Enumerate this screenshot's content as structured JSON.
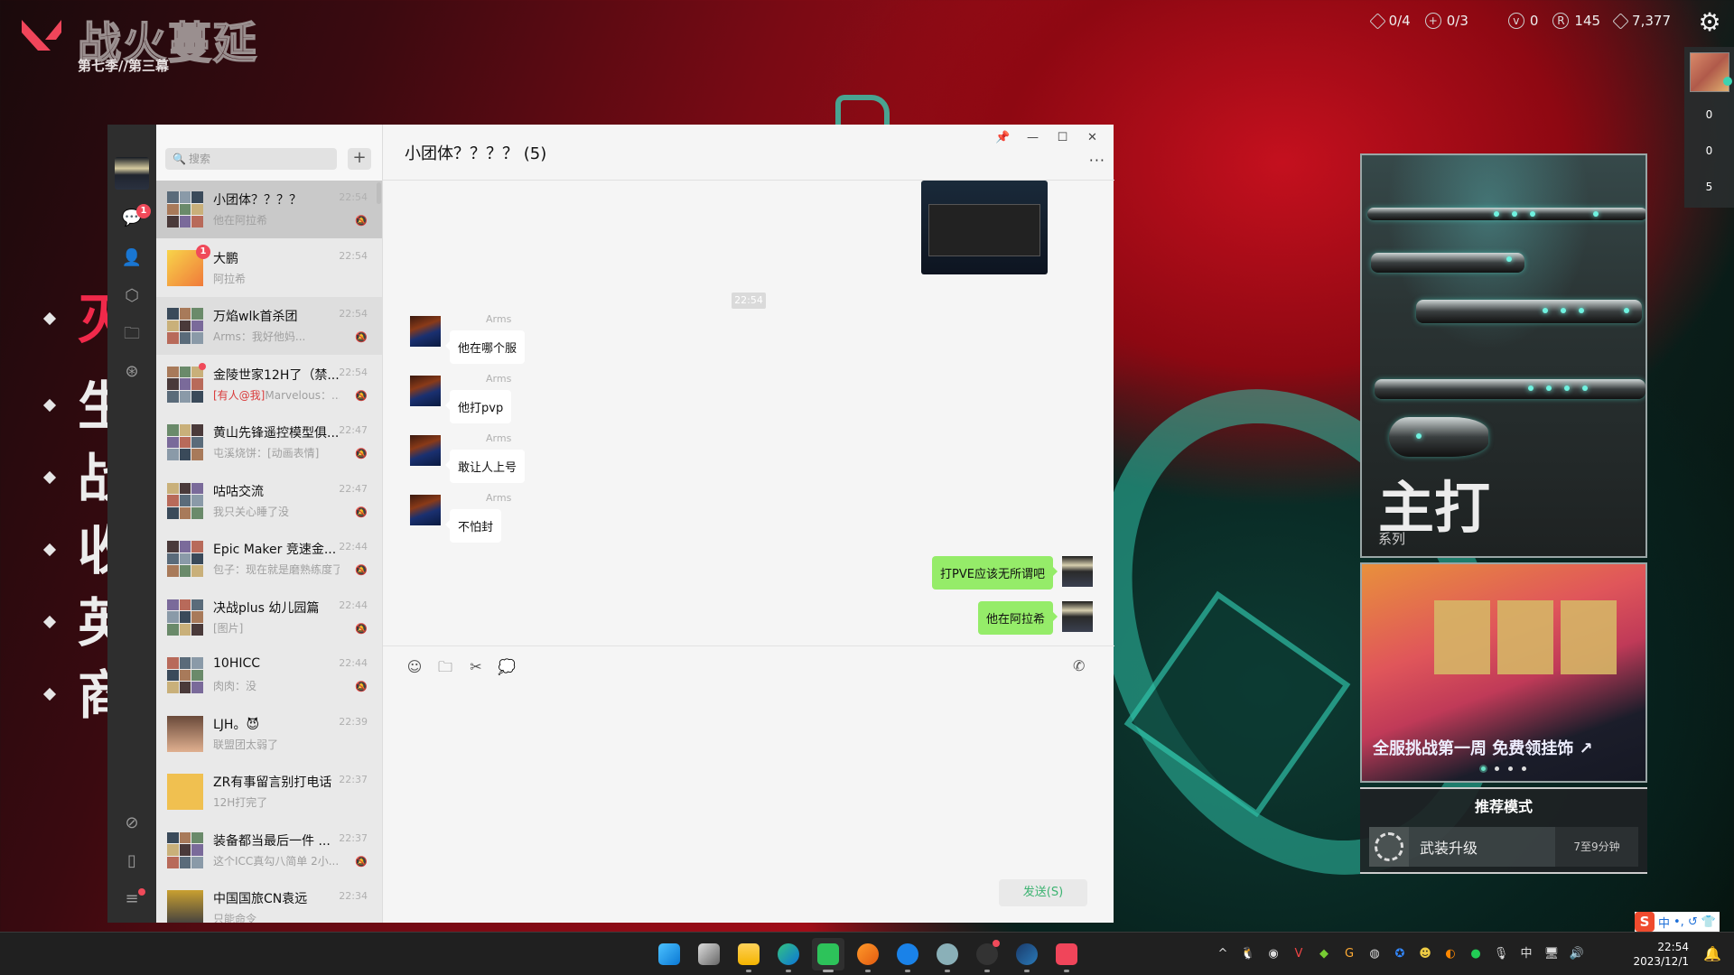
{
  "game": {
    "brand_title": "战火蔓延",
    "brand_subtitle": "第七季//第三幕",
    "side_menu": [
      {
        "char": "灭"
      },
      {
        "char": "生"
      },
      {
        "char": "战"
      },
      {
        "char": "收"
      },
      {
        "char": "英"
      },
      {
        "char": "商"
      }
    ],
    "stats": [
      {
        "icon": "diamond-icon",
        "value": "0/4"
      },
      {
        "icon": "plus-circle-icon",
        "value": "0/3"
      },
      {
        "icon": "valorant-points-icon",
        "value": "0"
      },
      {
        "icon": "radianite-icon",
        "value": "145"
      },
      {
        "icon": "kingdom-credits-icon",
        "value": "7,377"
      }
    ],
    "friend_counts": [
      "0",
      "0",
      "5"
    ],
    "promo_series": {
      "title": "主打",
      "subtitle": "系列"
    },
    "promo_event": {
      "title": "全服挑战第一周 免费领挂饰",
      "page_count": 4,
      "active_page": 1
    },
    "recommend": {
      "heading": "推荐模式",
      "mode_name": "武装升级",
      "duration": "7至9分钟"
    }
  },
  "wechat": {
    "search_placeholder": "搜索",
    "nav_badge": "1",
    "chats": [
      {
        "name": "小团体？？？？",
        "preview": "他在阿拉希",
        "time": "22:54",
        "muted": true,
        "selected": true
      },
      {
        "name": "大鹏",
        "preview": "阿拉希",
        "time": "22:54",
        "muted": false,
        "badge": "1"
      },
      {
        "name": "万焰wlk首杀团",
        "preview": "Arms：我好他妈...",
        "time": "22:54",
        "muted": true
      },
      {
        "name": "金陵世家12H了（禁...",
        "preview_at": "[有人@我]",
        "preview": "Marvelous：...",
        "time": "22:54",
        "muted": true,
        "dot": true
      },
      {
        "name": "黄山先锋遥控模型俱...",
        "preview": "屯溪烧饼：[动画表情]",
        "time": "22:47",
        "muted": true
      },
      {
        "name": "咕咕交流",
        "preview": "我只关心睡了没",
        "time": "22:47",
        "muted": true
      },
      {
        "name": "Epic Maker  竞速金...",
        "preview": "包子：现在就是磨熟练度了",
        "time": "22:44",
        "muted": true
      },
      {
        "name": "决战plus  幼儿园篇",
        "preview": "[图片]",
        "time": "22:44",
        "muted": true
      },
      {
        "name": "10HICC",
        "preview": "肉肉：没",
        "time": "22:44",
        "muted": true
      },
      {
        "name": "LJH。😈",
        "preview": "联盟团太弱了",
        "time": "22:39",
        "muted": false
      },
      {
        "name": "ZR有事留言别打电话",
        "preview": "12H打完了",
        "time": "22:37",
        "muted": false
      },
      {
        "name": "装备都当最后一件 ...",
        "preview": "这个ICC真勾八简单 2小...",
        "time": "22:37",
        "muted": true
      },
      {
        "name": "中国国旅CN袁远",
        "preview": "只能命令",
        "time": "22:34",
        "muted": false
      }
    ],
    "conversation": {
      "title": "小团体？？？？ (5)",
      "time_divider": "22:54",
      "messages": [
        {
          "sender": "Arms",
          "text": "他在哪个服",
          "side": "left"
        },
        {
          "sender": "Arms",
          "text": "他打pvp",
          "side": "left"
        },
        {
          "sender": "Arms",
          "text": "敢让人上号",
          "side": "left"
        },
        {
          "sender": "Arms",
          "text": "不怕封",
          "side": "left"
        },
        {
          "sender": "me",
          "text": "打PVE应该无所谓吧",
          "side": "right"
        },
        {
          "sender": "me",
          "text": "他在阿拉希",
          "side": "right"
        }
      ],
      "send_label": "发送(S)"
    }
  },
  "taskbar": {
    "apps": [
      "windows-start",
      "task-view",
      "file-explorer",
      "edge",
      "wechat",
      "leigod",
      "battle-net",
      "squirtle-app",
      "obs",
      "steam",
      "valorant"
    ],
    "active_app": "wechat",
    "time": "22:54",
    "date": "2023/12/1",
    "ime_lang": "中",
    "ime_toolbar": [
      "中",
      "•,",
      "↺",
      "👕"
    ]
  }
}
